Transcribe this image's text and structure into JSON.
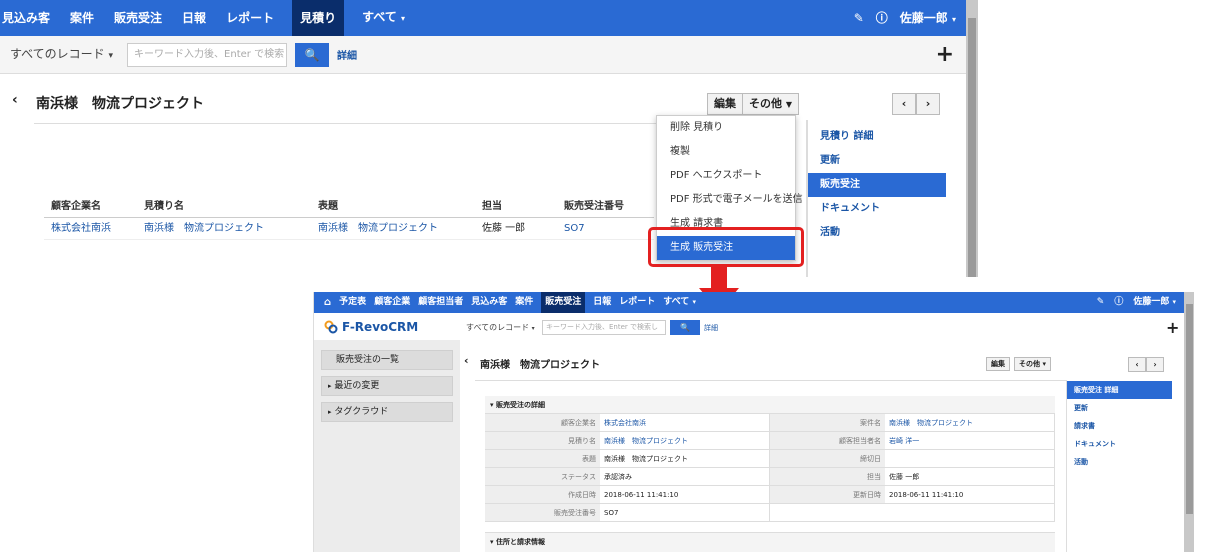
{
  "top": {
    "nav": {
      "items": [
        "見込み客",
        "案件",
        "販売受注",
        "日報",
        "レポート",
        "見積り",
        "すべて"
      ],
      "user": "佐藤一郎"
    },
    "search": {
      "scope": "すべてのレコード",
      "placeholder": "キーワード入力後、Enter で検索し",
      "detail": "詳細"
    },
    "record_title": "南浜様　物流プロジェクト",
    "buttons": {
      "edit": "編集",
      "more": "その他"
    },
    "table": {
      "headers": [
        "顧客企業名",
        "見積り名",
        "表題",
        "担当",
        "販売受注番号"
      ],
      "row": [
        "株式会社南浜",
        "南浜様　物流プロジェクト",
        "南浜様　物流プロジェクト",
        "佐藤 一郎",
        "SO7"
      ]
    },
    "dropdown": [
      "削除 見積り",
      "複製",
      "PDF へエクスポート",
      "PDF 形式で電子メールを送信",
      "生成 請求書",
      "生成 販売受注"
    ],
    "right_menu": [
      "見積り 詳細",
      "更新",
      "販売受注",
      "ドキュメント",
      "活動"
    ]
  },
  "bottom": {
    "nav": {
      "items": [
        "予定表",
        "顧客企業",
        "顧客担当者",
        "見込み客",
        "案件",
        "販売受注",
        "日報",
        "レポート",
        "すべて"
      ],
      "user": "佐藤一郎"
    },
    "logo": "F-RevoCRM",
    "search": {
      "scope": "すべてのレコード",
      "placeholder": "キーワード入力後、Enter で検索し",
      "detail": "詳細"
    },
    "sidebar": [
      "販売受注の一覧",
      "最近の変更",
      "タグクラウド"
    ],
    "record_title": "南浜様　物流プロジェクト",
    "buttons": {
      "edit": "編集",
      "more": "その他"
    },
    "section_title": "販売受注の詳細",
    "details": [
      {
        "l1": "顧客企業名",
        "v1": "株式会社南浜",
        "l2": "案件名",
        "v2": "南浜様　物流プロジェクト"
      },
      {
        "l1": "見積り名",
        "v1": "南浜様　物流プロジェクト",
        "l2": "顧客担当者名",
        "v2": "岩崎 洋一"
      },
      {
        "l1": "表題",
        "v1": "南浜様　物流プロジェクト",
        "l2": "締切日",
        "v2": ""
      },
      {
        "l1": "ステータス",
        "v1": "承認済み",
        "l2": "担当",
        "v2": "佐藤 一郎"
      },
      {
        "l1": "作成日時",
        "v1": "2018-06-11 11:41:10",
        "l2": "更新日時",
        "v2": "2018-06-11 11:41:10"
      },
      {
        "l1": "販売受注番号",
        "v1": "SO7",
        "l2": "",
        "v2": ""
      }
    ],
    "next_section": "住所と請求情報",
    "right_menu": [
      "販売受注 詳細",
      "更新",
      "請求書",
      "ドキュメント",
      "活動"
    ]
  },
  "colors": {
    "accent": "#2a6ad3",
    "nav_active": "#0a2d6b",
    "highlight": "#e32020"
  }
}
